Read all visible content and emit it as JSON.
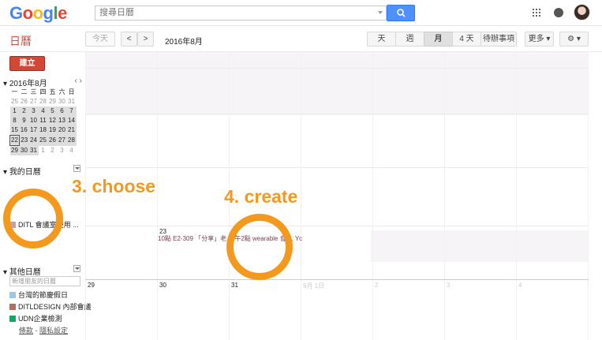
{
  "header": {
    "logo_letters": [
      {
        "ch": "G",
        "color": "#4285f4"
      },
      {
        "ch": "o",
        "color": "#ea4335"
      },
      {
        "ch": "o",
        "color": "#fbbc05"
      },
      {
        "ch": "g",
        "color": "#4285f4"
      },
      {
        "ch": "l",
        "color": "#34a853"
      },
      {
        "ch": "e",
        "color": "#ea4335"
      }
    ],
    "search_placeholder": "搜尋日曆",
    "search_icon": "search-icon",
    "apps_icon": "apps-grid-icon",
    "notifications_icon": "notifications-icon"
  },
  "toolbar": {
    "app_title": "日曆",
    "today_label": "今天",
    "prev_label": "<",
    "next_label": ">",
    "date_range": "2016年8月",
    "views": [
      "天",
      "週",
      "月",
      "4 天",
      "待辦事項"
    ],
    "active_view": "月",
    "more_label": "更多 ▾",
    "settings_label": "⚙ ▾"
  },
  "sidebar": {
    "create_label": "建立",
    "mini_cal": {
      "title": "2016年8月",
      "nav": "‹  ›",
      "weekdays": [
        "一",
        "二",
        "三",
        "四",
        "五",
        "六",
        "日"
      ],
      "weeks": [
        [
          "25",
          "26",
          "27",
          "28",
          "29",
          "30",
          "31"
        ],
        [
          "1",
          "2",
          "3",
          "4",
          "5",
          "6",
          "7"
        ],
        [
          "8",
          "9",
          "10",
          "11",
          "12",
          "13",
          "14"
        ],
        [
          "15",
          "16",
          "17",
          "18",
          "19",
          "20",
          "21"
        ],
        [
          "22",
          "23",
          "24",
          "25",
          "26",
          "27",
          "28"
        ],
        [
          "29",
          "30",
          "31",
          "1",
          "2",
          "3",
          "4"
        ]
      ],
      "today": "22"
    },
    "my_calendars_title": "我的日曆",
    "my_calendars": [
      {
        "label": "DITL 會議室使用 ...",
        "color": "#c9a0a8"
      }
    ],
    "other_calendars_title": "其他日曆",
    "friend_placeholder": "新增朋友的日曆",
    "other_calendars": [
      {
        "label": "台灣的節慶假日",
        "color": "#9fc6e7"
      },
      {
        "label": "DITLDESIGN 內部會議",
        "color": "#ac725e"
      },
      {
        "label": "UDN企業檢測",
        "color": "#16a765"
      }
    ],
    "footer_terms": "條款",
    "footer_sep": " - ",
    "footer_privacy": "隱私設定"
  },
  "month_grid": {
    "row5_days": [
      "",
      "23",
      "",
      "",
      "",
      "",
      ""
    ],
    "row6_days": [
      "29",
      "30",
      "31",
      "9月 1日",
      "2",
      "3",
      "4"
    ],
    "event_text": "10點 E2-309 「分享」老人 午2點 wearable 會 ... Yc"
  },
  "annotations": {
    "choose": "3. choose",
    "create": "4. create",
    "accent_color": "#f39a1e"
  }
}
